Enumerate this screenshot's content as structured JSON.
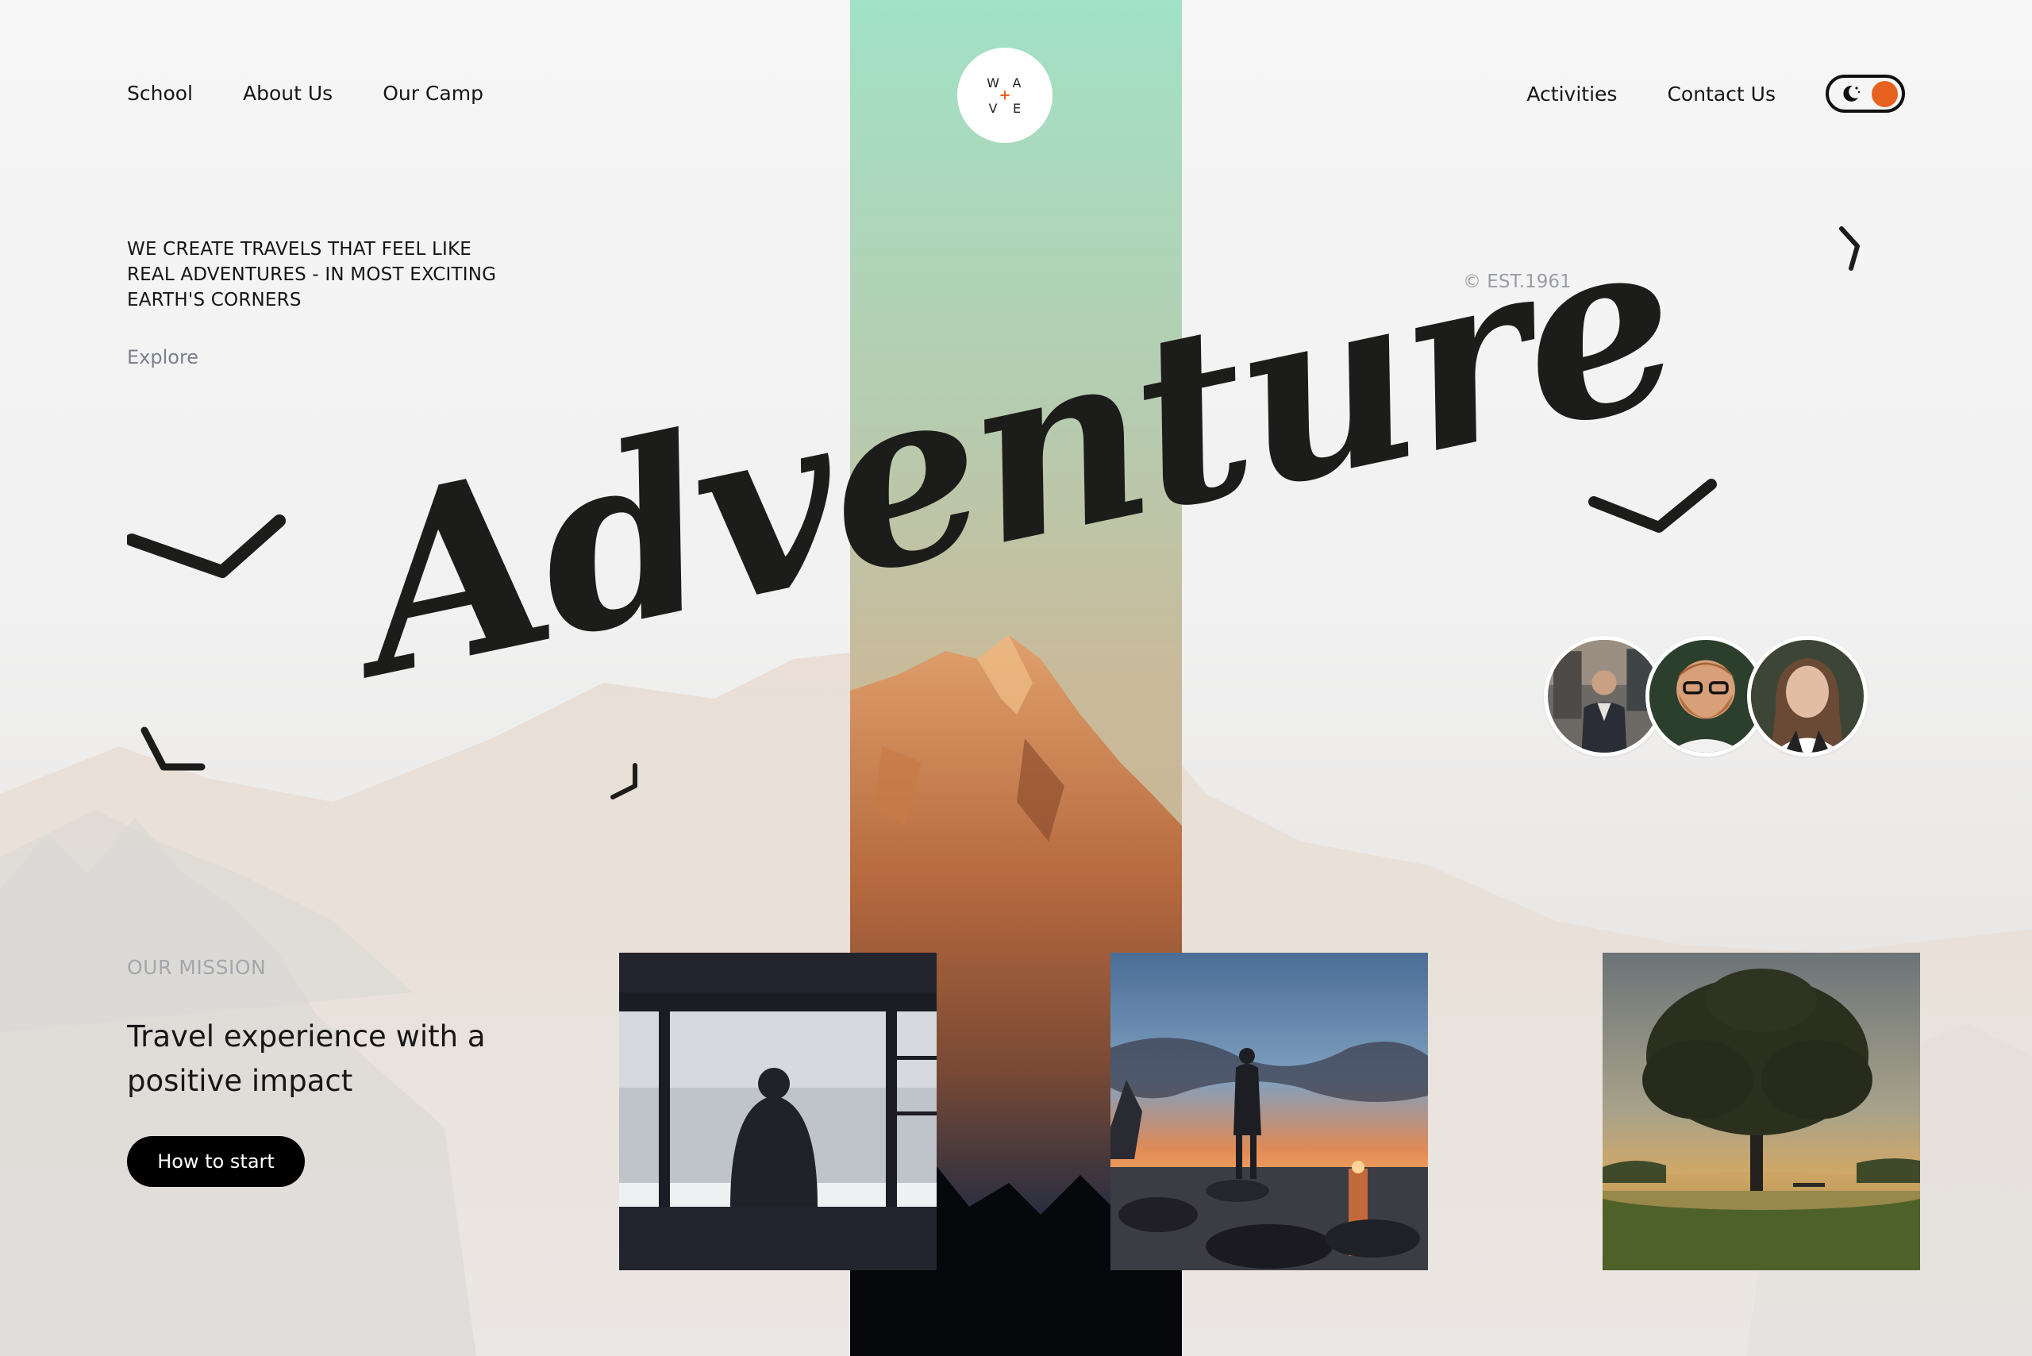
{
  "brand": {
    "logo_letters": [
      "W",
      "A",
      "V",
      "E"
    ],
    "logo_mark": "+"
  },
  "nav": {
    "left": [
      "School",
      "About Us",
      "Our Camp"
    ],
    "right": [
      "Activities",
      "Contact Us"
    ],
    "theme_toggle": {
      "icon": "moon-icon",
      "state": "on"
    }
  },
  "hero": {
    "tagline": "WE CREATE TRAVELS THAT FEEL LIKE REAL ADVENTURES - IN MOST EXCITING EARTH'S CORNERS",
    "explore": "Explore",
    "headline": "Adventure",
    "established": "© EST.1961"
  },
  "avatars": [
    "man-in-vest-avatar",
    "bearded-man-avatar",
    "woman-avatar"
  ],
  "mission": {
    "label": "OUR MISSION",
    "title": "Travel experience with a positive impact",
    "cta": "How to start"
  },
  "gallery": [
    {
      "subject": "person-at-window-photo"
    },
    {
      "subject": "sunset-on-rocks-photo"
    },
    {
      "subject": "lone-tree-photo"
    }
  ],
  "colors": {
    "accent": "#e8621f",
    "band_top": "#a2e2c6",
    "text": "#141414",
    "muted": "#7c7f8c",
    "label": "#a4a6ac"
  }
}
